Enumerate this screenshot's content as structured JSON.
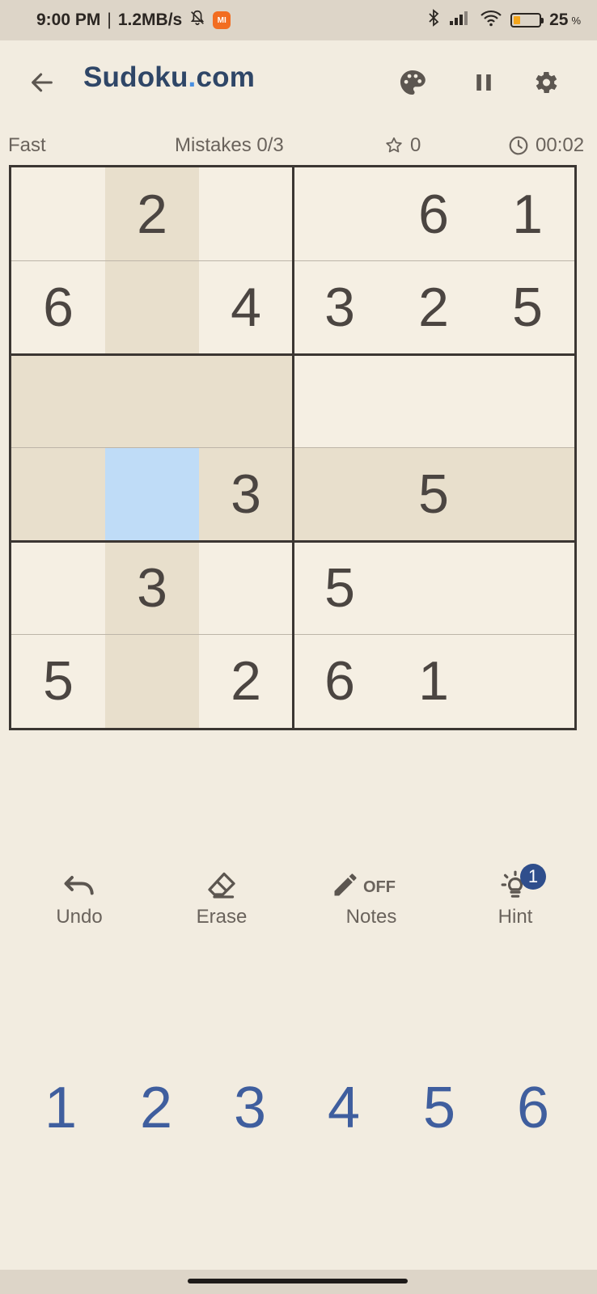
{
  "status_bar": {
    "time": "9:00 PM",
    "separator": "|",
    "speed": "1.2MB/s",
    "app_badge": "MI",
    "battery_level": "25",
    "battery_unit": "%",
    "battery_fraction": 0.25
  },
  "header": {
    "title_prefix": "Sudoku",
    "title_dot": ".",
    "title_suffix": "com"
  },
  "info": {
    "difficulty": "Fast",
    "mistakes": "Mistakes 0/3",
    "stars": "0",
    "timer": "00:02"
  },
  "board": {
    "rows": [
      [
        "",
        "2",
        "",
        "",
        "6",
        "1"
      ],
      [
        "6",
        "",
        "4",
        "3",
        "2",
        "5"
      ],
      [
        "",
        "",
        "",
        "",
        "",
        ""
      ],
      [
        "",
        "",
        "3",
        "",
        "5",
        ""
      ],
      [
        "",
        "3",
        "",
        "5",
        "",
        ""
      ],
      [
        "5",
        "",
        "2",
        "6",
        "1",
        ""
      ]
    ],
    "selected_cell": [
      3,
      1
    ]
  },
  "tools": {
    "undo": "Undo",
    "erase": "Erase",
    "notes": "Notes",
    "notes_state": "OFF",
    "hint": "Hint",
    "hint_count": "1"
  },
  "numpad": [
    "1",
    "2",
    "3",
    "4",
    "5",
    "6"
  ],
  "colors": {
    "background": "#f2ece0",
    "title": "#2f4667",
    "title_dot": "#4a90e2",
    "number_pad": "#3f5e9e",
    "highlight": "#e8dfcc",
    "selected": "#bfdcf7",
    "hint_badge": "#2f4e8c"
  }
}
